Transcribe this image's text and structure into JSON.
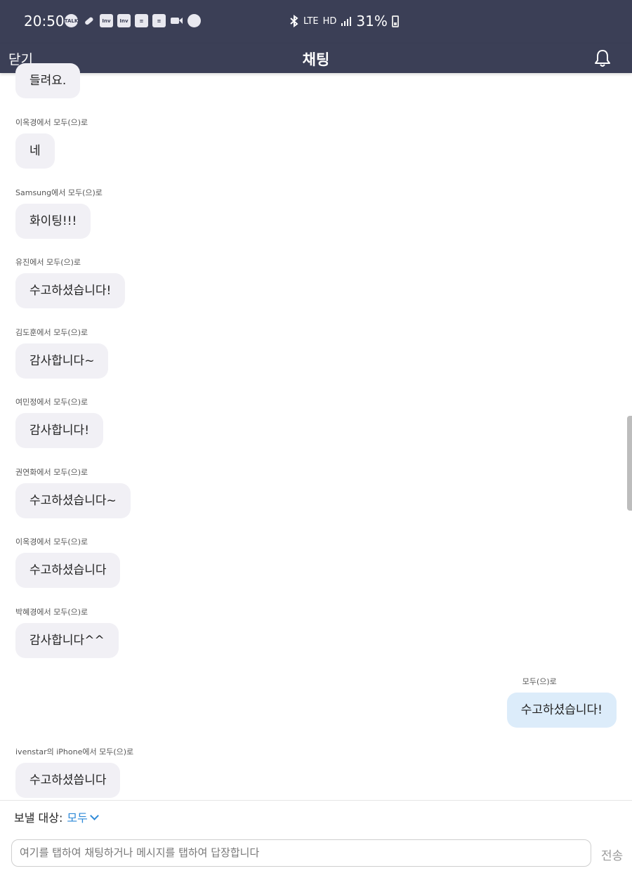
{
  "status_bar": {
    "time": "20:50",
    "notification_icons": [
      "talk-icon",
      "pill-icon",
      "inv-icon",
      "inv-icon",
      "note-icon",
      "note-icon",
      "video-icon",
      "chat-bubble-icon"
    ],
    "network_label": "LTE",
    "hd_label": "HD",
    "battery": "31%"
  },
  "header": {
    "close_label": "닫기",
    "title": "채팅",
    "bell_icon": "bell-icon"
  },
  "messages": [
    {
      "sender": "",
      "text": "들려요.",
      "outgoing": false
    },
    {
      "sender": "이옥경에서 모두(으)로",
      "text": "네",
      "outgoing": false
    },
    {
      "sender": "Samsung에서 모두(으)로",
      "text": "화이팅!!!",
      "outgoing": false
    },
    {
      "sender": "유진에서 모두(으)로",
      "text": "수고하셨습니다!",
      "outgoing": false
    },
    {
      "sender": "김도훈에서 모두(으)로",
      "text": "감사합니다~",
      "outgoing": false
    },
    {
      "sender": "여민정에서 모두(으)로",
      "text": "감사합니다!",
      "outgoing": false
    },
    {
      "sender": "권연화에서 모두(으)로",
      "text": "수고하셨습니다~",
      "outgoing": false
    },
    {
      "sender": "이옥경에서 모두(으)로",
      "text": "수고하셨습니다",
      "outgoing": false
    },
    {
      "sender": "박혜경에서 모두(으)로",
      "text": "감사합니다^^",
      "outgoing": false
    },
    {
      "sender": "모두(으)로",
      "text": "수고하셨습니다!",
      "outgoing": true
    },
    {
      "sender": "ivenstar의 iPhone에서 모두(으)로",
      "text": "수고하셨씁니다",
      "outgoing": false
    }
  ],
  "composer": {
    "recipient_label": "보낼 대상:",
    "recipient_value": "모두",
    "input_placeholder": "여기를 탭하여 채팅하거나 메시지를 탭하여 답장합니다",
    "send_label": "전송"
  },
  "colors": {
    "header_bg": "#3b3f56",
    "incoming_bubble": "#f1f0f5",
    "outgoing_bubble": "#dcecfa",
    "accent": "#2e8ad8"
  }
}
